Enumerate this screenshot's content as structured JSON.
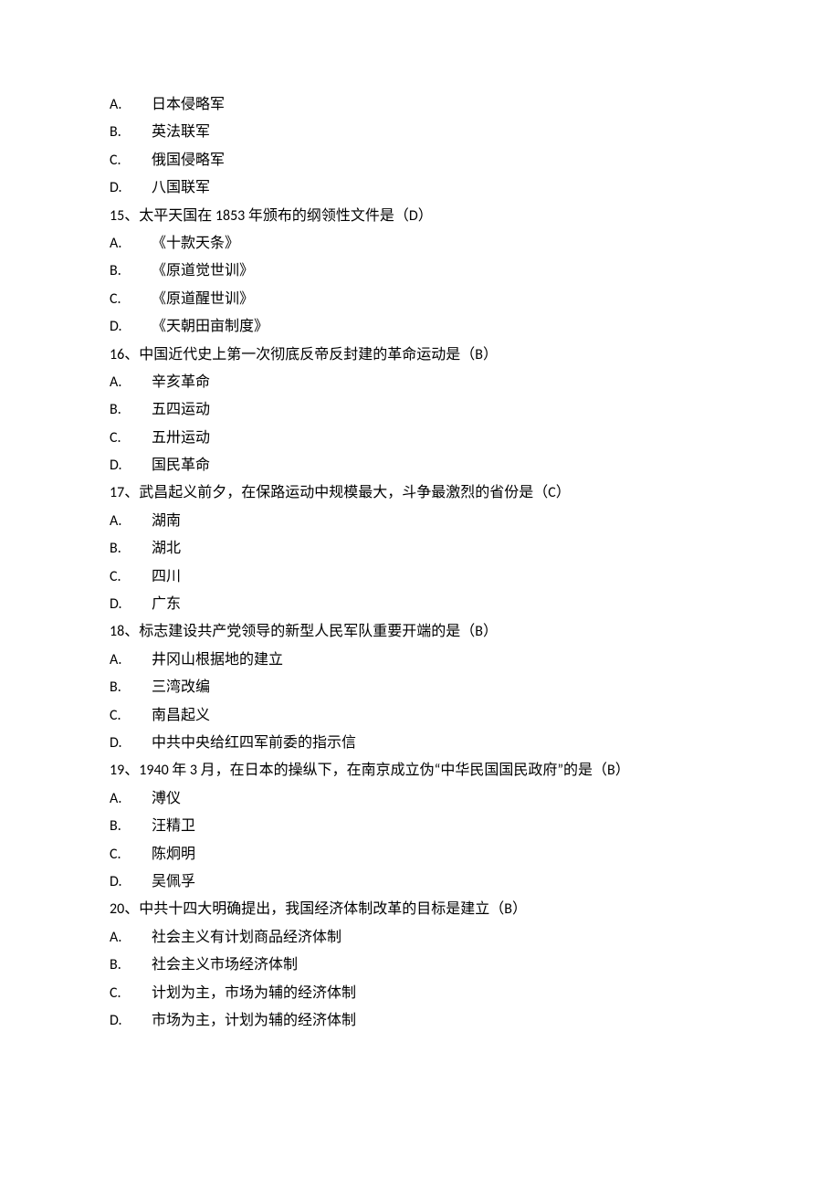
{
  "questions": [
    {
      "prefix": "",
      "stem": "",
      "options": [
        {
          "letter": "A.",
          "text": "日本侵略军"
        },
        {
          "letter": "B.",
          "text": "英法联军"
        },
        {
          "letter": "C.",
          "text": "俄国侵略军"
        },
        {
          "letter": "D.",
          "text": "八国联军"
        }
      ]
    },
    {
      "prefix": "15、",
      "stem": "太平天国在 1853 年颁布的纲领性文件是（D）",
      "options": [
        {
          "letter": "A.",
          "text": "《十款天条》"
        },
        {
          "letter": "B.",
          "text": "《原道觉世训》"
        },
        {
          "letter": "C.",
          "text": "《原道醒世训》"
        },
        {
          "letter": "D.",
          "text": "《天朝田亩制度》"
        }
      ]
    },
    {
      "prefix": "16、",
      "stem": "中国近代史上第一次彻底反帝反封建的革命运动是（B）",
      "options": [
        {
          "letter": "A.",
          "text": "辛亥革命"
        },
        {
          "letter": "B.",
          "text": "五四运动"
        },
        {
          "letter": "C.",
          "text": "五卅运动"
        },
        {
          "letter": "D.",
          "text": "国民革命"
        }
      ]
    },
    {
      "prefix": "17、",
      "stem": "武昌起义前夕，在保路运动中规模最大，斗争最激烈的省份是（C）",
      "options": [
        {
          "letter": "A.",
          "text": "湖南"
        },
        {
          "letter": "B.",
          "text": "湖北"
        },
        {
          "letter": "C.",
          "text": "四川"
        },
        {
          "letter": "D.",
          "text": "广东"
        }
      ]
    },
    {
      "prefix": "18、",
      "stem": "标志建设共产党领导的新型人民军队重要开端的是（B）",
      "options": [
        {
          "letter": "A.",
          "text": "井冈山根据地的建立"
        },
        {
          "letter": "B.",
          "text": "三湾改编"
        },
        {
          "letter": "C.",
          "text": "南昌起义"
        },
        {
          "letter": "D.",
          "text": "中共中央给红四军前委的指示信"
        }
      ]
    },
    {
      "prefix": "19、",
      "stem": "1940 年 3 月，在日本的操纵下，在南京成立伪“中华民国国民政府”的是（B）",
      "options": [
        {
          "letter": "A.",
          "text": "溥仪"
        },
        {
          "letter": "B.",
          "text": "汪精卫"
        },
        {
          "letter": "C.",
          "text": "陈炯明"
        },
        {
          "letter": "D.",
          "text": "吴佩孚"
        }
      ]
    },
    {
      "prefix": "20、",
      "stem": "中共十四大明确提出，我国经济体制改革的目标是建立（B）",
      "options": [
        {
          "letter": "A.",
          "text": "社会主义有计划商品经济体制"
        },
        {
          "letter": "B.",
          "text": "社会主义市场经济体制"
        },
        {
          "letter": "C.",
          "text": "计划为主，市场为辅的经济体制"
        },
        {
          "letter": "D.",
          "text": "市场为主，计划为辅的经济体制"
        }
      ]
    }
  ]
}
